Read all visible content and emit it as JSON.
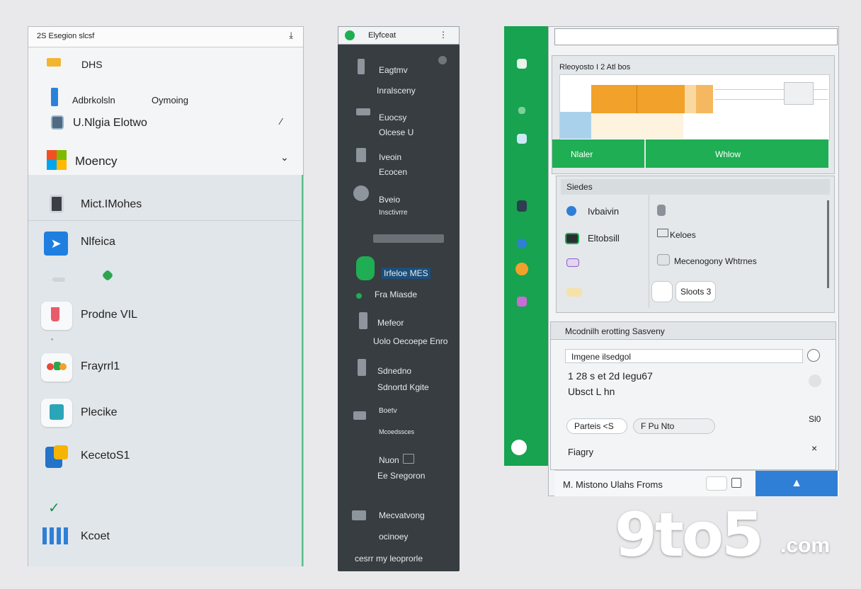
{
  "panel_left": {
    "title": "2S  Esegion slcsf",
    "rows": [
      {
        "label": "DHS"
      },
      {
        "label": "Adbrkolsln",
        "secondary": "Oymoing"
      },
      {
        "label": "U.Nlgia Elotwo"
      },
      {
        "label": "Moency"
      },
      {
        "label": "Mict.IMohes"
      },
      {
        "label": "Nlfeica"
      },
      {
        "label": "Prodne VIL"
      },
      {
        "label": "Frayrrl1"
      },
      {
        "label": "Plecike"
      },
      {
        "label": "KecetoS1"
      },
      {
        "label": "Kcoet"
      }
    ]
  },
  "panel_middle": {
    "title": "Elyfceat",
    "items": [
      {
        "label": "Eagtmv"
      },
      {
        "label": "Inralsceny"
      },
      {
        "label": "Euocsy"
      },
      {
        "label": "Olcese U"
      },
      {
        "label": "Iveoin"
      },
      {
        "label": "Ecocen"
      },
      {
        "label": "Bveio"
      },
      {
        "label": "Insctivrre"
      },
      {
        "label": "Irfeloe MES"
      },
      {
        "label": "Fra Miasde"
      },
      {
        "label": "Mefeor"
      },
      {
        "label": "Uolo Oecoepe Enro"
      },
      {
        "label": "Sdnedno"
      },
      {
        "label": "Sdnortd Kgite"
      },
      {
        "label": "Boetv"
      },
      {
        "label": "Mcoedssces"
      },
      {
        "label": "Nuon"
      },
      {
        "label": "Ee Sregoron"
      },
      {
        "label": "Mecvatvong"
      },
      {
        "label": "ocinoey"
      },
      {
        "label": "cesrr my leoprorle"
      }
    ]
  },
  "panel_right": {
    "chart_card_title": "Rleoyosto I 2 Atl bos",
    "green_tabs": [
      "Nlaler",
      "Whlow"
    ],
    "status_title": "Siedes",
    "status_items": [
      {
        "label": "Ivbaivin"
      },
      {
        "label": "Eltobsill"
      },
      {
        "label": "Keloes"
      },
      {
        "label": "Mecenogony Whtrnes"
      }
    ],
    "pill": "Sloots 3",
    "settings_title": "Mcodnilh erotting Sasveny",
    "input_value": "Imgene ilsedgol",
    "detail_lines": [
      "1 28 s et 2d Iegu67",
      "Ubsct L hn"
    ],
    "toggle_labels": [
      "Parteis <S",
      "F Pu Nto"
    ],
    "side_value": "Sl0",
    "extra_label": "Fiagry",
    "footer_text": "M. Mistono Ulahs Froms"
  },
  "watermark": {
    "brand": "9to5",
    "suffix": ".com"
  },
  "colors": {
    "accent_green": "#1fae53",
    "accent_blue": "#2f7fd6",
    "orange": "#f2a12a",
    "dark": "#383d42"
  }
}
